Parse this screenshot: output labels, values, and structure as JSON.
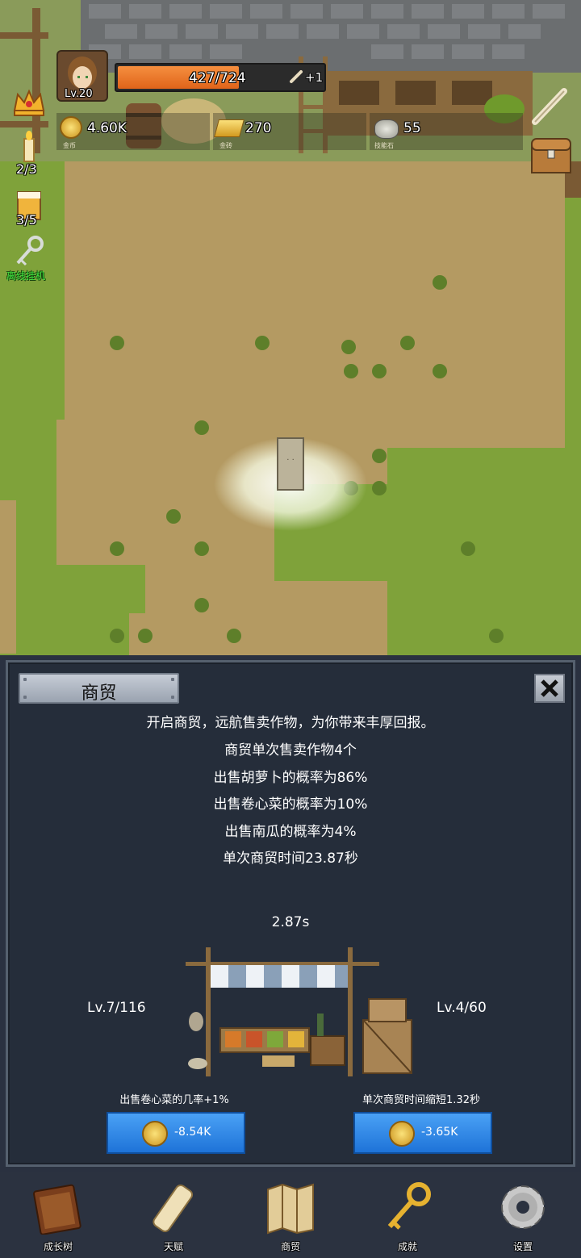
{
  "hud": {
    "level": "Lv.20",
    "exp_text": "427/724",
    "exp_fraction": 0.59,
    "bonus": "+1",
    "resources": [
      {
        "name": "gold-coin",
        "value": "4.60K",
        "label": "金币"
      },
      {
        "name": "gold-brick",
        "value": "270",
        "label": "金砖"
      },
      {
        "name": "skill-stone",
        "value": "55",
        "label": "技能石"
      }
    ]
  },
  "side": {
    "candle_count": "2/3",
    "beer_count": "3/5",
    "idle_label": "离线挂机"
  },
  "panel": {
    "title": "商贸",
    "description": [
      "开启商贸，远航售卖作物，为你带来丰厚回报。",
      "商贸单次售卖作物4个",
      "出售胡萝卜的概率为86%",
      "出售卷心菜的概率为10%",
      "出售南瓜的概率为4%",
      "单次商贸时间23.87秒"
    ],
    "timer": "2.87s",
    "left": {
      "level": "Lv.7/116",
      "effect": "出售卷心菜的几率+1%",
      "cost": "-8.54K"
    },
    "right": {
      "level": "Lv.4/60",
      "effect": "单次商贸时间缩短1.32秒",
      "cost": "-3.65K"
    }
  },
  "nav": [
    {
      "label": "成长树",
      "icon": "book-icon"
    },
    {
      "label": "天赋",
      "icon": "scroll-icon"
    },
    {
      "label": "商贸",
      "icon": "map-icon"
    },
    {
      "label": "成就",
      "icon": "key-icon"
    },
    {
      "label": "设置",
      "icon": "gear-icon"
    }
  ],
  "colors": {
    "exp_bar": "#f07a28",
    "button_blue": "#2a86e8",
    "panel_bg": "#252d3a",
    "idle_green": "#3fe03f"
  }
}
